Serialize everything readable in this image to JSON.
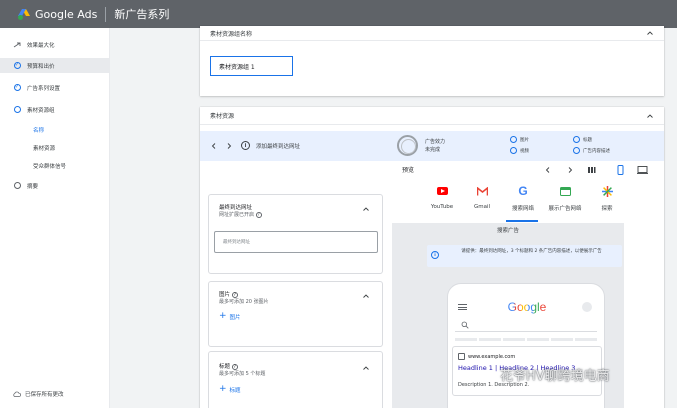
{
  "header": {
    "app_title": "Google Ads",
    "campaign_title": "新广告系列"
  },
  "sidebar": {
    "items": [
      {
        "label": "效果最大化"
      },
      {
        "label": "预算和出价"
      },
      {
        "label": "广告系列设置"
      },
      {
        "label": "素材资源组"
      },
      {
        "label": "名称"
      },
      {
        "label": "素材资源"
      },
      {
        "label": "受众群体信号"
      },
      {
        "label": "摘要"
      }
    ],
    "footer": "已保存所有更改"
  },
  "asset_group_name": {
    "header": "素材资源组名称",
    "value": "素材资源组 1"
  },
  "assets": {
    "header": "素材资源",
    "strip_label": "添加最终到达网址",
    "strength_title": "广告效力",
    "strength_value": "未完成",
    "checks": [
      "图片",
      "标题",
      "视频",
      "广告内容描述"
    ]
  },
  "final_url": {
    "title": "最终到达网址",
    "desc": "网址扩展已开启",
    "placeholder": "最终到达网址"
  },
  "images": {
    "title": "图片",
    "desc": "最多可添加 20 张图片",
    "add_label": "图片"
  },
  "headlines": {
    "title": "标题",
    "desc": "最多可添加 5 个标题",
    "add_label": "标题"
  },
  "preview": {
    "label": "预览",
    "networks": [
      {
        "label": "YouTube",
        "color": "#ff0000"
      },
      {
        "label": "Gmail",
        "color": "#ea4335"
      },
      {
        "label": "搜索网络",
        "color": "#4285f4"
      },
      {
        "label": "展示广告网络",
        "color": "#34a853"
      },
      {
        "label": "探索",
        "color": "#fbbc04"
      }
    ],
    "section_title": "搜索广告",
    "notice": "请提供：最终到达网址，3 个标题和 2 条广告内容描述，以便展示广告",
    "phone": {
      "brand": "Google",
      "ad_url": "www.example.com",
      "headline": "Headline 1 | Headline 2 | Headline 3",
      "description": "Description 1. Description 2."
    }
  },
  "watermark": "花爷HV聊跨境电商"
}
